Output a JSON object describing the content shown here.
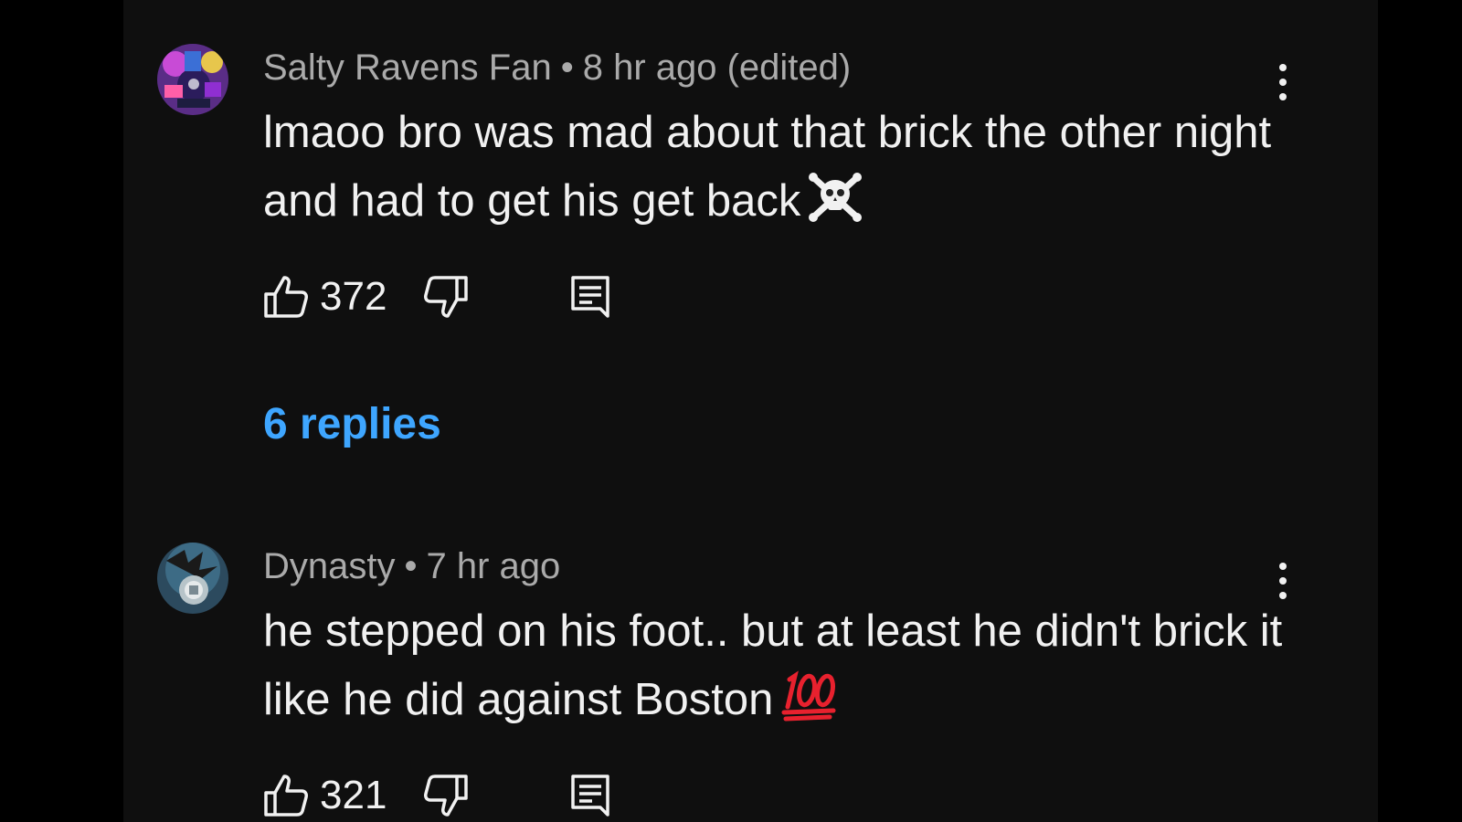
{
  "comments": [
    {
      "author": "Salty Ravens Fan",
      "separator": "•",
      "time": "8 hr ago (edited)",
      "text": "lmaoo bro was mad about that brick the other night and had to get his get back",
      "emoji_icon": "skull-and-crossbones-icon",
      "likes": "372",
      "replies_label": "6 replies"
    },
    {
      "author": "Dynasty",
      "separator": "•",
      "time": "7 hr ago",
      "text": "he stepped on his foot.. but at least he didn't brick it like he did against Boston",
      "emoji_icon": "hundred-points-icon",
      "likes": "321"
    }
  ],
  "colors": {
    "background": "#0f0f0f",
    "outer": "#000000",
    "text": "#f1f1f1",
    "meta": "#aaaaaa",
    "link": "#3ea6ff",
    "hundred": "#e8212e"
  }
}
